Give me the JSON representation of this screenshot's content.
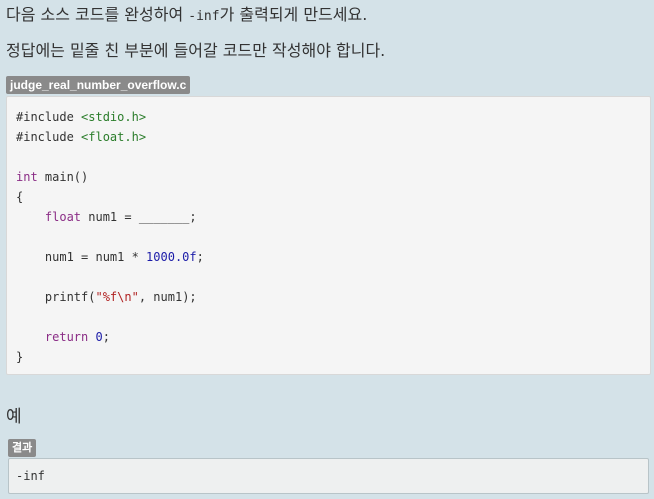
{
  "instructions": {
    "line1_before": "다음 소스 코드를 완성하여 ",
    "line1_code": "-inf",
    "line1_after": "가 출력되게 만드세요.",
    "line2": "정답에는 밑줄 친 부분에 들어갈 코드만 작성해야 합니다."
  },
  "code_block": {
    "filename": "judge_real_number_overflow.c",
    "lines": [
      [
        {
          "t": "pp",
          "v": "#include "
        },
        {
          "t": "header",
          "v": "<stdio.h>"
        }
      ],
      [
        {
          "t": "pp",
          "v": "#include "
        },
        {
          "t": "header",
          "v": "<float.h>"
        }
      ],
      [],
      [
        {
          "t": "kw",
          "v": "int"
        },
        {
          "t": "plain",
          "v": " main()"
        }
      ],
      [
        {
          "t": "plain",
          "v": "{"
        }
      ],
      [
        {
          "t": "plain",
          "v": "    "
        },
        {
          "t": "kw",
          "v": "float"
        },
        {
          "t": "plain",
          "v": " num1 = _______;"
        }
      ],
      [],
      [
        {
          "t": "plain",
          "v": "    num1 = num1 * "
        },
        {
          "t": "num",
          "v": "1000.0f"
        },
        {
          "t": "plain",
          "v": ";"
        }
      ],
      [],
      [
        {
          "t": "plain",
          "v": "    printf("
        },
        {
          "t": "str",
          "v": "\"%f\\n\""
        },
        {
          "t": "plain",
          "v": ", num1);"
        }
      ],
      [],
      [
        {
          "t": "plain",
          "v": "    "
        },
        {
          "t": "kw",
          "v": "return"
        },
        {
          "t": "plain",
          "v": " "
        },
        {
          "t": "num",
          "v": "0"
        },
        {
          "t": "plain",
          "v": ";"
        }
      ],
      [
        {
          "t": "plain",
          "v": "}"
        }
      ]
    ]
  },
  "example": {
    "heading": "예",
    "result_label": "결과",
    "result_output": "-inf"
  }
}
